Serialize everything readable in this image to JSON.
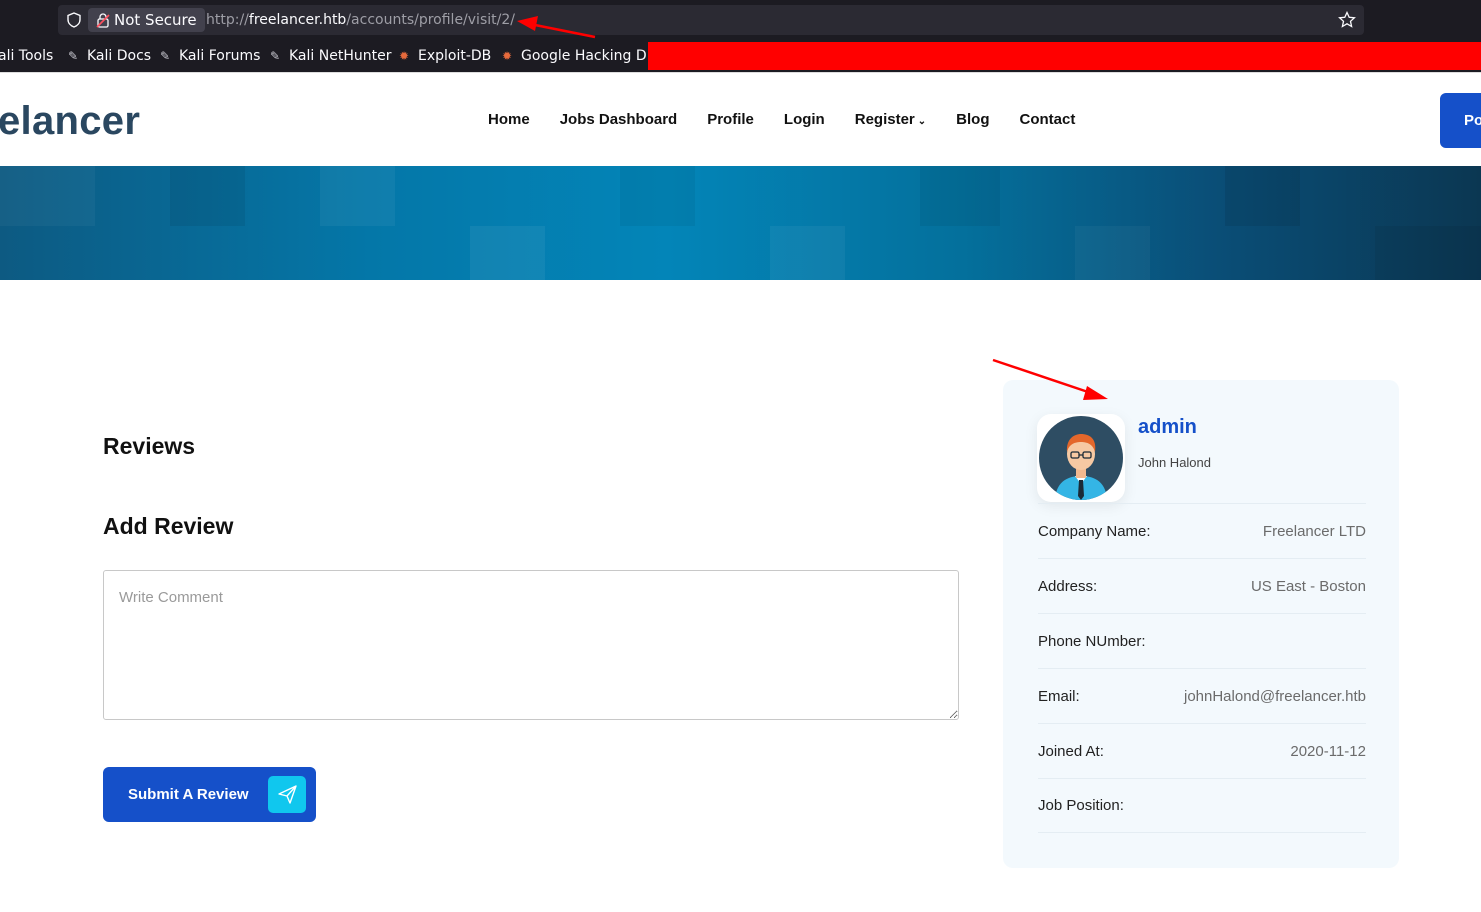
{
  "browser": {
    "not_secure_label": "Not Secure",
    "url_scheme": "http://",
    "url_host": "freelancer.htb",
    "url_path": "/accounts/profile/visit/2/",
    "bookmarks": [
      {
        "label": "ali Tools",
        "icon": "kali-dragon-icon"
      },
      {
        "label": "Kali Docs",
        "icon": "kali-dragon-icon"
      },
      {
        "label": "Kali Forums",
        "icon": "kali-dragon-icon"
      },
      {
        "label": "Kali NetHunter",
        "icon": "kali-dragon-icon"
      },
      {
        "label": "Exploit-DB",
        "icon": "exploit-db-icon"
      },
      {
        "label": "Google Hacking DB",
        "icon": "exploit-db-icon"
      }
    ]
  },
  "site": {
    "logo": "elancer",
    "nav": [
      "Home",
      "Jobs Dashboard",
      "Profile",
      "Login",
      "Register",
      "Blog",
      "Contact"
    ],
    "post_button": "Po"
  },
  "content": {
    "reviews_title": "Reviews",
    "add_review_title": "Add Review",
    "comment_placeholder": "Write Comment",
    "submit_label": "Submit A Review"
  },
  "profile": {
    "username": "admin",
    "full_name": "John Halond",
    "fields": [
      {
        "label": "Company Name:",
        "value": "Freelancer LTD"
      },
      {
        "label": "Address:",
        "value": "US East - Boston"
      },
      {
        "label": "Phone NUmber:",
        "value": ""
      },
      {
        "label": "Email:",
        "value": "johnHalond@freelancer.htb"
      },
      {
        "label": "Joined At:",
        "value": "2020-11-12"
      },
      {
        "label": "Job Position:",
        "value": ""
      }
    ]
  },
  "colors": {
    "primary": "#1550c9",
    "accent": "#10c7ee",
    "annotation": "#ff0000"
  }
}
